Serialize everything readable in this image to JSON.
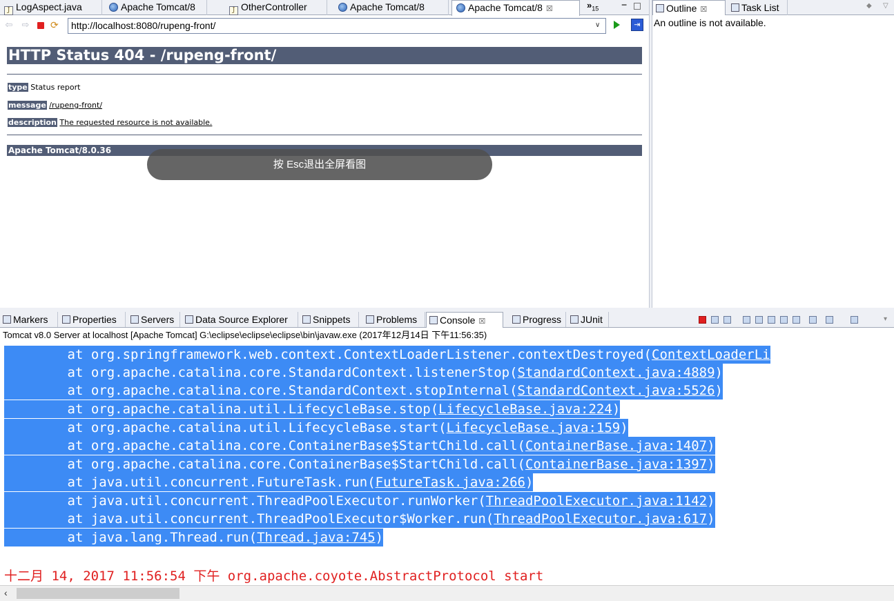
{
  "editor": {
    "tabs": [
      {
        "label": "LogAspect.java",
        "icon": "java-file-icon"
      },
      {
        "label": "Apache Tomcat/8",
        "icon": "globe-icon"
      },
      {
        "label": "OtherController",
        "icon": "java-file-icon"
      },
      {
        "label": "Apache Tomcat/8",
        "icon": "globe-icon"
      },
      {
        "label": "Apache Tomcat/8",
        "icon": "globe-icon",
        "active": true
      }
    ],
    "overflow_label": "»",
    "overflow_count": "15",
    "close_glyph": "☒"
  },
  "browser": {
    "url": "http://localhost:8080/rupeng-front/"
  },
  "page": {
    "heading": "HTTP Status 404 - /rupeng-front/",
    "type_label": "type",
    "type_value": "Status report",
    "message_label": "message",
    "message_value": "/rupeng-front/",
    "description_label": "description",
    "description_value": "The requested resource is not available.",
    "footer": "Apache Tomcat/8.0.36",
    "toast": "按 Esc退出全屏看图"
  },
  "outline": {
    "tabs": [
      {
        "label": "Outline",
        "icon": "outline-icon",
        "active": true
      },
      {
        "label": "Task List",
        "icon": "task-list-icon"
      }
    ],
    "message": "An outline is not available."
  },
  "bottom": {
    "tabs": [
      {
        "label": "Markers",
        "icon": "markers-icon"
      },
      {
        "label": "Properties",
        "icon": "properties-icon"
      },
      {
        "label": "Servers",
        "icon": "servers-icon"
      },
      {
        "label": "Data Source Explorer",
        "icon": "data-source-icon"
      },
      {
        "label": "Snippets",
        "icon": "snippets-icon"
      },
      {
        "label": "Problems",
        "icon": "problems-icon"
      },
      {
        "label": "Console",
        "icon": "console-icon",
        "active": true
      },
      {
        "label": "Progress",
        "icon": "progress-icon"
      },
      {
        "label": "JUnit",
        "icon": "junit-icon"
      }
    ],
    "console_title": "Tomcat v8.0 Server at localhost [Apache Tomcat] G:\\eclipse\\eclipse\\eclipse\\bin\\javaw.exe (2017年12月14日 下午11:56:35)",
    "lines": [
      {
        "prefix": "\tat org.springframework.web.context.ContextLoaderListener.contextDestroyed(",
        "link": "ContextLoaderLi",
        "suffix": ""
      },
      {
        "prefix": "\tat org.apache.catalina.core.StandardContext.listenerStop(",
        "link": "StandardContext.java:4889",
        "suffix": ")"
      },
      {
        "prefix": "\tat org.apache.catalina.core.StandardContext.stopInternal(",
        "link": "StandardContext.java:5526",
        "suffix": ")"
      },
      {
        "prefix": "\tat org.apache.catalina.util.LifecycleBase.stop(",
        "link": "LifecycleBase.java:224",
        "suffix": ")"
      },
      {
        "prefix": "\tat org.apache.catalina.util.LifecycleBase.start(",
        "link": "LifecycleBase.java:159",
        "suffix": ")"
      },
      {
        "prefix": "\tat org.apache.catalina.core.ContainerBase$StartChild.call(",
        "link": "ContainerBase.java:1407",
        "suffix": ")"
      },
      {
        "prefix": "\tat org.apache.catalina.core.ContainerBase$StartChild.call(",
        "link": "ContainerBase.java:1397",
        "suffix": ")"
      },
      {
        "prefix": "\tat java.util.concurrent.FutureTask.run(",
        "link": "FutureTask.java:266",
        "suffix": ")"
      },
      {
        "prefix": "\tat java.util.concurrent.ThreadPoolExecutor.runWorker(",
        "link": "ThreadPoolExecutor.java:1142",
        "suffix": ")"
      },
      {
        "prefix": "\tat java.util.concurrent.ThreadPoolExecutor$Worker.run(",
        "link": "ThreadPoolExecutor.java:617",
        "suffix": ")"
      },
      {
        "prefix": "\tat java.lang.Thread.run(",
        "link": "Thread.java:745",
        "suffix": ")"
      }
    ],
    "last_line": "十二月 14, 2017 11:56:54 下午 org.apache.coyote.AbstractProtocol start"
  },
  "colors": {
    "selection": "#3d8bf5",
    "tomcat_header": "#525d76",
    "error_text": "#e02020"
  }
}
